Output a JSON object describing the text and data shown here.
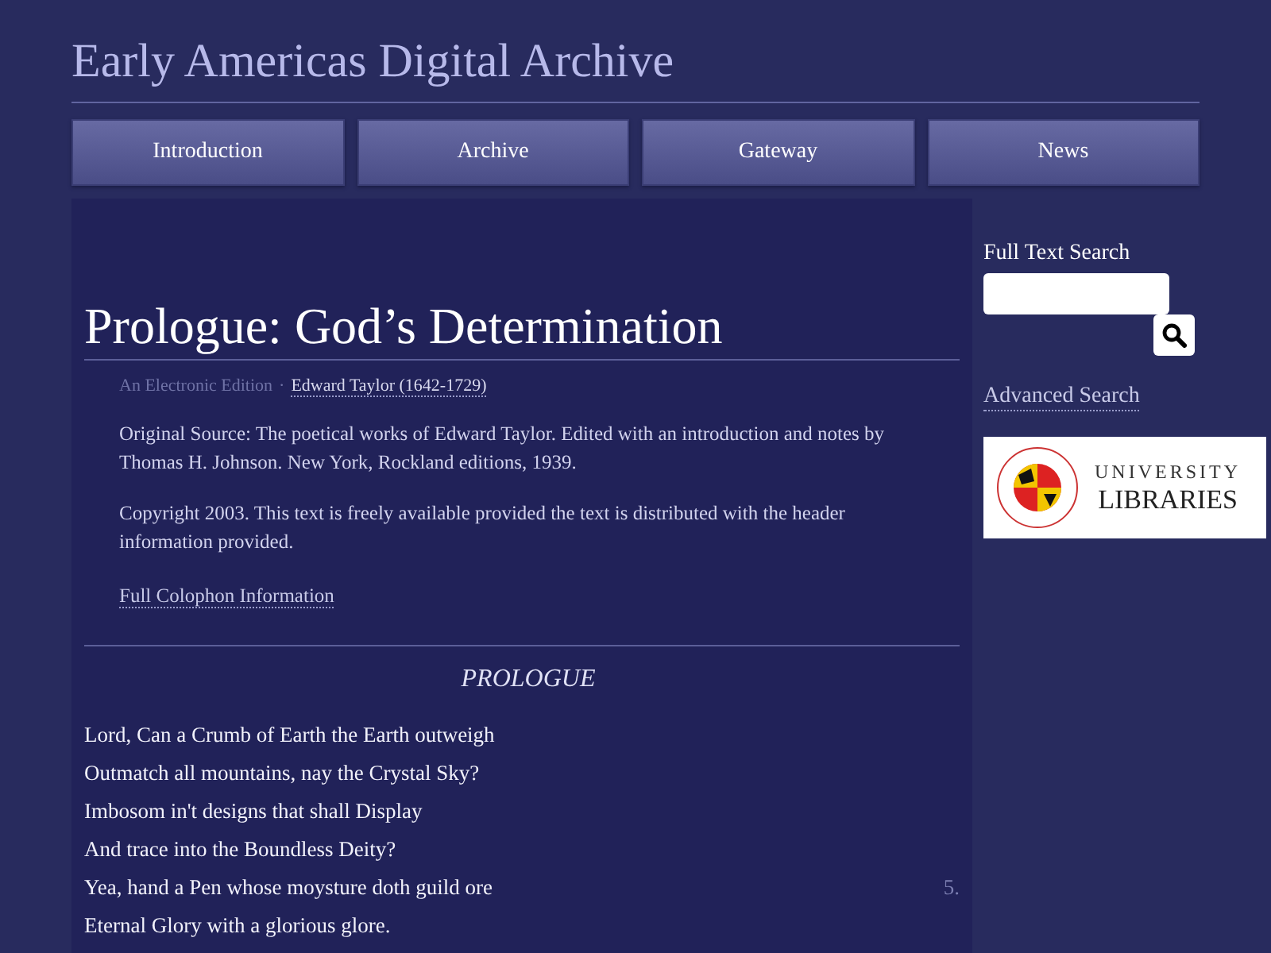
{
  "site_title": "Early Americas Digital Archive",
  "nav": [
    {
      "label": "Introduction"
    },
    {
      "label": "Archive"
    },
    {
      "label": "Gateway"
    },
    {
      "label": "News"
    }
  ],
  "page_title": "Prologue: God’s Determination",
  "edition": "An Electronic Edition",
  "separator": "·",
  "author_link": "Edward Taylor (1642-1729)",
  "source": "Original Source: The poetical works of Edward Taylor. Edited with an introduction and notes by Thomas H. Johnson. New York, Rockland editions, 1939.",
  "copyright": "Copyright 2003. This text is freely available provided the text is distributed with the header information provided.",
  "colophon_link": "Full Colophon Information",
  "poem_heading": "PROLOGUE",
  "lines": [
    {
      "text": "Lord, Can a Crumb of Earth the Earth outweigh"
    },
    {
      "text": "Outmatch all mountains, nay the Crystal Sky?"
    },
    {
      "text": "Imbosom in't designs that shall Display"
    },
    {
      "text": "And trace into the Boundless Deity?"
    },
    {
      "text": "Yea, hand a Pen whose moysture doth guild ore",
      "number": "5."
    },
    {
      "text": "Eternal Glory with a glorious glore."
    }
  ],
  "sidebar": {
    "search_label": "Full Text Search",
    "advanced_link": "Advanced Search",
    "logo_line1": "UNIVERSITY",
    "logo_line2": "LIBRARIES"
  }
}
